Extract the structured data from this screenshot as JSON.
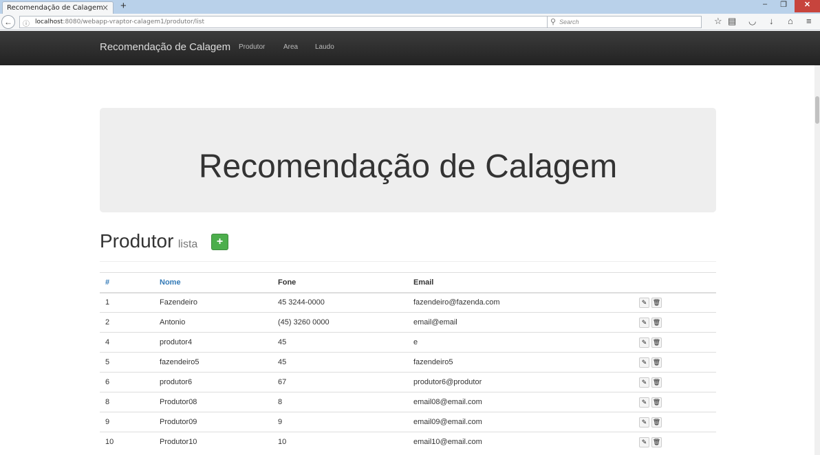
{
  "browser": {
    "tab_title": "Recomendação de Calagem",
    "tab_close": "×",
    "new_tab": "+",
    "url_host": "localhost",
    "url_rest": ":8080/webapp-vraptor-calagem1/produtor/list",
    "search_placeholder": "Search",
    "window_minimize": "–",
    "window_maximize": "❐",
    "window_close": "✕"
  },
  "nav": {
    "brand": "Recomendação de Calagem",
    "links": [
      "Produtor",
      "Area",
      "Laudo"
    ]
  },
  "jumbotron": {
    "title": "Recomendação de Calagem"
  },
  "page": {
    "title": "Produtor",
    "subtitle": "lista",
    "add_label": "+"
  },
  "table": {
    "headers": {
      "id": "#",
      "nome": "Nome",
      "fone": "Fone",
      "email": "Email"
    },
    "rows": [
      {
        "id": "1",
        "nome": "Fazendeiro",
        "fone": "45 3244-0000",
        "email": "fazendeiro@fazenda.com"
      },
      {
        "id": "2",
        "nome": "Antonio",
        "fone": "(45) 3260 0000",
        "email": "email@email"
      },
      {
        "id": "4",
        "nome": "produtor4",
        "fone": "45",
        "email": "e"
      },
      {
        "id": "5",
        "nome": "fazendeiro5",
        "fone": "45",
        "email": "fazendeiro5"
      },
      {
        "id": "6",
        "nome": "produtor6",
        "fone": "67",
        "email": "produtor6@produtor"
      },
      {
        "id": "8",
        "nome": "Produtor08",
        "fone": "8",
        "email": "email08@email.com"
      },
      {
        "id": "9",
        "nome": "Produtor09",
        "fone": "9",
        "email": "email09@email.com"
      },
      {
        "id": "10",
        "nome": "Produtor10",
        "fone": "10",
        "email": "email10@email.com"
      }
    ]
  },
  "colors": {
    "navbar": "#222222",
    "link_blue": "#337ab7",
    "success": "#4cae4c",
    "jumbotron": "#eeeeee"
  }
}
